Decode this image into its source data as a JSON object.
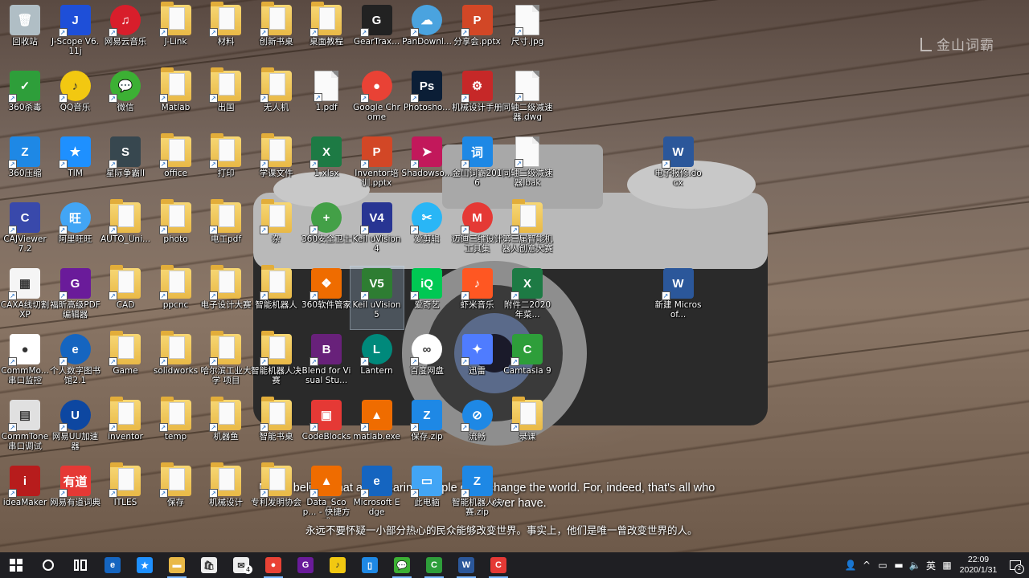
{
  "watermark": "金山词霸",
  "quote": {
    "en_line1": "Never believe that a few caring people can't change the world. For, indeed, that's all who",
    "en_line2": "ever have.",
    "cn_line": "永远不要怀疑一小部分热心的民众能够改变世界。事实上，他们是唯一曾改变世界的人。"
  },
  "colors": {
    "taskbar_bg": "#1f1f23",
    "selection": "#a0bedc"
  },
  "icons": [
    {
      "label": "回收站",
      "col": 0,
      "row": 0,
      "icon": "recycle-bin-icon",
      "color": "#b0bec5",
      "text": "🗑"
    },
    {
      "label": "J-Scope V6.11j",
      "col": 1,
      "row": 0,
      "icon": "jscope-icon",
      "color": "#1e4fd8",
      "text": "J"
    },
    {
      "label": "网易云音乐",
      "col": 2,
      "row": 0,
      "icon": "netease-music-icon",
      "color": "#d81e2b",
      "text": "♫",
      "round": true
    },
    {
      "label": "J-Link",
      "col": 3,
      "row": 0,
      "icon": "folder-icon",
      "kind": "folder"
    },
    {
      "label": "材料",
      "col": 4,
      "row": 0,
      "icon": "folder-icon",
      "kind": "folder"
    },
    {
      "label": "创新书桌",
      "col": 5,
      "row": 0,
      "icon": "folder-icon",
      "kind": "folder"
    },
    {
      "label": "桌面教程",
      "col": 6,
      "row": 0,
      "icon": "folder-icon",
      "kind": "folder"
    },
    {
      "label": "GearTrax...",
      "col": 7,
      "row": 0,
      "icon": "geartrax-icon",
      "color": "#222222",
      "text": "G"
    },
    {
      "label": "PanDownl...",
      "col": 8,
      "row": 0,
      "icon": "cloud-icon",
      "color": "#4aa3df",
      "text": "☁",
      "round": true
    },
    {
      "label": "分享会.pptx",
      "col": 9,
      "row": 0,
      "icon": "pptx-file-icon",
      "color": "#d24726",
      "text": "P"
    },
    {
      "label": "尺寸.jpg",
      "col": 10,
      "row": 0,
      "icon": "image-file-icon",
      "kind": "file"
    },
    {
      "label": "360杀毒",
      "col": 0,
      "row": 1,
      "icon": "shield-icon",
      "color": "#2e9e3a",
      "text": "✓"
    },
    {
      "label": "QQ音乐",
      "col": 1,
      "row": 1,
      "icon": "qq-music-icon",
      "color": "#f2c811",
      "text": "♪",
      "round": true
    },
    {
      "label": "微信",
      "col": 2,
      "row": 1,
      "icon": "wechat-icon",
      "color": "#3cb034",
      "text": "💬",
      "round": true
    },
    {
      "label": "Matlab",
      "col": 3,
      "row": 1,
      "icon": "folder-icon",
      "kind": "folder"
    },
    {
      "label": "出国",
      "col": 4,
      "row": 1,
      "icon": "folder-icon",
      "kind": "folder"
    },
    {
      "label": "无人机",
      "col": 5,
      "row": 1,
      "icon": "folder-icon",
      "kind": "folder"
    },
    {
      "label": "1.pdf",
      "col": 6,
      "row": 1,
      "icon": "pdf-file-icon",
      "kind": "file"
    },
    {
      "label": "Google Chrome",
      "col": 7,
      "row": 1,
      "icon": "chrome-icon",
      "color": "#e94235",
      "text": "●",
      "round": true
    },
    {
      "label": "Photosho...",
      "col": 8,
      "row": 1,
      "icon": "photoshop-icon",
      "color": "#0b1e36",
      "text": "Ps"
    },
    {
      "label": "机械设计手册",
      "col": 9,
      "row": 1,
      "icon": "gear-book-icon",
      "color": "#c62828",
      "text": "⚙"
    },
    {
      "label": "同轴二级减速器.dwg",
      "col": 10,
      "row": 1,
      "icon": "dwg-file-icon",
      "kind": "file"
    },
    {
      "label": "360压缩",
      "col": 0,
      "row": 2,
      "icon": "zip-icon",
      "color": "#1e88e5",
      "text": "Z"
    },
    {
      "label": "TIM",
      "col": 1,
      "row": 2,
      "icon": "tim-icon",
      "color": "#1e90ff",
      "text": "★"
    },
    {
      "label": "星际争霸II",
      "col": 2,
      "row": 2,
      "icon": "starcraft-icon",
      "color": "#37474f",
      "text": "S"
    },
    {
      "label": "office",
      "col": 3,
      "row": 2,
      "icon": "folder-icon",
      "kind": "folder"
    },
    {
      "label": "打印",
      "col": 4,
      "row": 2,
      "icon": "folder-icon",
      "kind": "folder"
    },
    {
      "label": "学课文件",
      "col": 5,
      "row": 2,
      "icon": "folder-icon",
      "kind": "folder"
    },
    {
      "label": "1.xlsx",
      "col": 6,
      "row": 2,
      "icon": "excel-file-icon",
      "color": "#1d7a44",
      "text": "X"
    },
    {
      "label": "Inventor培训.pptx",
      "col": 7,
      "row": 2,
      "icon": "pptx-file-icon",
      "color": "#d24726",
      "text": "P"
    },
    {
      "label": "Shadowso...",
      "col": 8,
      "row": 2,
      "icon": "shadowsocks-icon",
      "color": "#c2185b",
      "text": "➤"
    },
    {
      "label": "金山词霸2016",
      "col": 9,
      "row": 2,
      "icon": "dictionary-icon",
      "color": "#1e88e5",
      "text": "词"
    },
    {
      "label": "同轴二级减速器.bak",
      "col": 10,
      "row": 2,
      "icon": "bak-file-icon",
      "kind": "file"
    },
    {
      "label": "电子报修.docx",
      "col": 13,
      "row": 2,
      "icon": "word-file-icon",
      "color": "#2b579a",
      "text": "W"
    },
    {
      "label": "CAJViewer 7.2",
      "col": 0,
      "row": 3,
      "icon": "cajviewer-icon",
      "color": "#3949ab",
      "text": "C"
    },
    {
      "label": "阿里旺旺",
      "col": 1,
      "row": 3,
      "icon": "aliwangwang-icon",
      "color": "#42a5f5",
      "text": "旺",
      "round": true
    },
    {
      "label": "AUTO_Uni...",
      "col": 2,
      "row": 3,
      "icon": "folder-icon",
      "kind": "folder"
    },
    {
      "label": "photo",
      "col": 3,
      "row": 3,
      "icon": "folder-icon",
      "kind": "folder"
    },
    {
      "label": "电工pdf",
      "col": 4,
      "row": 3,
      "icon": "folder-icon",
      "kind": "folder"
    },
    {
      "label": "杂",
      "col": 5,
      "row": 3,
      "icon": "folder-icon",
      "kind": "folder"
    },
    {
      "label": "360安全卫士",
      "col": 6,
      "row": 3,
      "icon": "360-safe-icon",
      "color": "#43a047",
      "text": "+",
      "round": true
    },
    {
      "label": "Keil uVision4",
      "col": 7,
      "row": 3,
      "icon": "keil-icon",
      "color": "#283593",
      "text": "V4"
    },
    {
      "label": "爱剪辑",
      "col": 8,
      "row": 3,
      "icon": "aijianji-icon",
      "color": "#29b6f6",
      "text": "✂",
      "round": true
    },
    {
      "label": "迈迪三维设计工具集",
      "col": 9,
      "row": 3,
      "icon": "maidi-icon",
      "color": "#e53935",
      "text": "M",
      "round": true
    },
    {
      "label": "第三届智能机器人创意大赛",
      "col": 10,
      "row": 3,
      "icon": "folder-icon",
      "kind": "folder"
    },
    {
      "label": "CAXA线切割XP",
      "col": 0,
      "row": 4,
      "icon": "caxa-icon",
      "color": "#f5f5f5",
      "text": "▦"
    },
    {
      "label": "福昕高级PDF编辑器",
      "col": 1,
      "row": 4,
      "icon": "foxit-icon",
      "color": "#6a1b9a",
      "text": "G"
    },
    {
      "label": "CAD",
      "col": 2,
      "row": 4,
      "icon": "folder-icon",
      "kind": "folder"
    },
    {
      "label": "ppcnc",
      "col": 3,
      "row": 4,
      "icon": "folder-icon",
      "kind": "folder"
    },
    {
      "label": "电子设计大赛",
      "col": 4,
      "row": 4,
      "icon": "folder-icon",
      "kind": "folder"
    },
    {
      "label": "智能机器人",
      "col": 5,
      "row": 4,
      "icon": "folder-icon",
      "kind": "folder"
    },
    {
      "label": "360软件管家",
      "col": 6,
      "row": 4,
      "icon": "360-manager-icon",
      "color": "#ef6c00",
      "text": "❖"
    },
    {
      "label": "Keil uVision5",
      "col": 7,
      "row": 4,
      "icon": "keil-icon",
      "color": "#2e7d32",
      "text": "V5",
      "selected": true
    },
    {
      "label": "爱奇艺",
      "col": 8,
      "row": 4,
      "icon": "iqiyi-icon",
      "color": "#00c853",
      "text": "iQ"
    },
    {
      "label": "虾米音乐",
      "col": 9,
      "row": 4,
      "icon": "xiami-icon",
      "color": "#ff5722",
      "text": "♪"
    },
    {
      "label": "附件二2020年菜...",
      "col": 10,
      "row": 4,
      "icon": "excel-file-icon",
      "color": "#1d7a44",
      "text": "X"
    },
    {
      "label": "新建 Microsof...",
      "col": 13,
      "row": 4,
      "icon": "word-file-icon",
      "color": "#2b579a",
      "text": "W"
    },
    {
      "label": "CommMo...串口监控",
      "col": 0,
      "row": 5,
      "icon": "commmonitor-icon",
      "color": "#ffffff",
      "text": "●"
    },
    {
      "label": "个人数字图书馆2.1",
      "col": 1,
      "row": 5,
      "icon": "digital-library-icon",
      "color": "#1565c0",
      "text": "e",
      "round": true
    },
    {
      "label": "Game",
      "col": 2,
      "row": 5,
      "icon": "folder-icon",
      "kind": "folder"
    },
    {
      "label": "solidworks",
      "col": 3,
      "row": 5,
      "icon": "folder-icon",
      "kind": "folder"
    },
    {
      "label": "哈尔滨工业大学 项目",
      "col": 4,
      "row": 5,
      "icon": "folder-icon",
      "kind": "folder"
    },
    {
      "label": "智能机器人决赛",
      "col": 5,
      "row": 5,
      "icon": "folder-icon",
      "kind": "folder"
    },
    {
      "label": "Blend for Visual Stu...",
      "col": 6,
      "row": 5,
      "icon": "blend-icon",
      "color": "#68217a",
      "text": "B"
    },
    {
      "label": "Lantern",
      "col": 7,
      "row": 5,
      "icon": "lantern-icon",
      "color": "#00897b",
      "text": "L",
      "round": true
    },
    {
      "label": "百度网盘",
      "col": 8,
      "row": 5,
      "icon": "baidu-netdisk-icon",
      "color": "#ffffff",
      "text": "∞",
      "round": true
    },
    {
      "label": "迅雷",
      "col": 9,
      "row": 5,
      "icon": "xunlei-icon",
      "color": "#4f7cff",
      "text": "✦"
    },
    {
      "label": "Camtasia 9",
      "col": 10,
      "row": 5,
      "icon": "camtasia-icon",
      "color": "#2e9e3a",
      "text": "C"
    },
    {
      "label": "CommTone串口调试",
      "col": 0,
      "row": 6,
      "icon": "commtone-icon",
      "color": "#e0e0e0",
      "text": "▤"
    },
    {
      "label": "网易UU加速器",
      "col": 1,
      "row": 6,
      "icon": "uu-accelerator-icon",
      "color": "#0d47a1",
      "text": "U",
      "round": true
    },
    {
      "label": "inventor",
      "col": 2,
      "row": 6,
      "icon": "folder-icon",
      "kind": "folder"
    },
    {
      "label": "temp",
      "col": 3,
      "row": 6,
      "icon": "folder-icon",
      "kind": "folder"
    },
    {
      "label": "机器鱼",
      "col": 4,
      "row": 6,
      "icon": "folder-icon",
      "kind": "folder"
    },
    {
      "label": "智能书桌",
      "col": 5,
      "row": 6,
      "icon": "folder-icon",
      "kind": "folder"
    },
    {
      "label": "CodeBlocks",
      "col": 6,
      "row": 6,
      "icon": "codeblocks-icon",
      "color": "#e53935",
      "text": "▣"
    },
    {
      "label": "matlab.exe",
      "col": 7,
      "row": 6,
      "icon": "matlab-icon",
      "color": "#ef6c00",
      "text": "▲"
    },
    {
      "label": "保存.zip",
      "col": 8,
      "row": 6,
      "icon": "zip-icon",
      "color": "#1e88e5",
      "text": "Z"
    },
    {
      "label": "流畅",
      "col": 9,
      "row": 6,
      "icon": "liuchang-icon",
      "color": "#1e88e5",
      "text": "⊘",
      "round": true
    },
    {
      "label": "录课",
      "col": 10,
      "row": 6,
      "icon": "folder-icon",
      "kind": "folder"
    },
    {
      "label": "ideaMaker",
      "col": 0,
      "row": 7,
      "icon": "ideamaker-icon",
      "color": "#b71c1c",
      "text": "i"
    },
    {
      "label": "网易有道词典",
      "col": 1,
      "row": 7,
      "icon": "youdao-icon",
      "color": "#e53935",
      "text": "有道"
    },
    {
      "label": "ITLES",
      "col": 2,
      "row": 7,
      "icon": "folder-icon",
      "kind": "folder"
    },
    {
      "label": "保存",
      "col": 3,
      "row": 7,
      "icon": "folder-icon",
      "kind": "folder"
    },
    {
      "label": "机械设计",
      "col": 4,
      "row": 7,
      "icon": "folder-icon",
      "kind": "folder"
    },
    {
      "label": "专利发明协会",
      "col": 5,
      "row": 7,
      "icon": "folder-icon",
      "kind": "folder"
    },
    {
      "label": "Data_Scop... - 快捷方式",
      "col": 6,
      "row": 7,
      "icon": "data-scope-icon",
      "color": "#ef6c00",
      "text": "▲"
    },
    {
      "label": "Microsoft Edge",
      "col": 7,
      "row": 7,
      "icon": "edge-icon",
      "color": "#1565c0",
      "text": "e"
    },
    {
      "label": "此电脑",
      "col": 8,
      "row": 7,
      "icon": "this-pc-icon",
      "color": "#42a5f5",
      "text": "▭"
    },
    {
      "label": "智能机器人决赛.zip",
      "col": 9,
      "row": 7,
      "icon": "zip-icon",
      "color": "#1e88e5",
      "text": "Z"
    }
  ],
  "taskbar": {
    "apps": [
      {
        "name": "edge-taskbar-icon",
        "color": "#1565c0",
        "text": "e"
      },
      {
        "name": "tim-taskbar-icon",
        "color": "#1e90ff",
        "text": "★"
      },
      {
        "name": "file-explorer-taskbar-icon",
        "color": "#e9b947",
        "text": "▬",
        "running": true
      },
      {
        "name": "store-taskbar-icon",
        "color": "#eeeeee",
        "text": "🛍"
      },
      {
        "name": "mail-taskbar-icon",
        "color": "#eeeeee",
        "text": "✉",
        "badge": "4"
      },
      {
        "name": "chrome-taskbar-icon",
        "color": "#e94235",
        "text": "●",
        "running": true
      },
      {
        "name": "foxit-taskbar-icon",
        "color": "#6a1b9a",
        "text": "G"
      },
      {
        "name": "qq-music-taskbar-icon",
        "color": "#f2c811",
        "text": "♪"
      },
      {
        "name": "phone-taskbar-icon",
        "color": "#1e88e5",
        "text": "▯"
      },
      {
        "name": "wechat-taskbar-icon",
        "color": "#3cb034",
        "text": "💬",
        "running": true
      },
      {
        "name": "camtasia-taskbar-icon",
        "color": "#2e9e3a",
        "text": "C",
        "running": true
      },
      {
        "name": "word-taskbar-icon",
        "color": "#2b579a",
        "text": "W",
        "running": true
      },
      {
        "name": "recorder-taskbar-icon",
        "color": "#e53935",
        "text": "C",
        "running": true
      }
    ],
    "ime": "英",
    "time": "22:09",
    "date": "2020/1/31",
    "notifications": "2"
  }
}
